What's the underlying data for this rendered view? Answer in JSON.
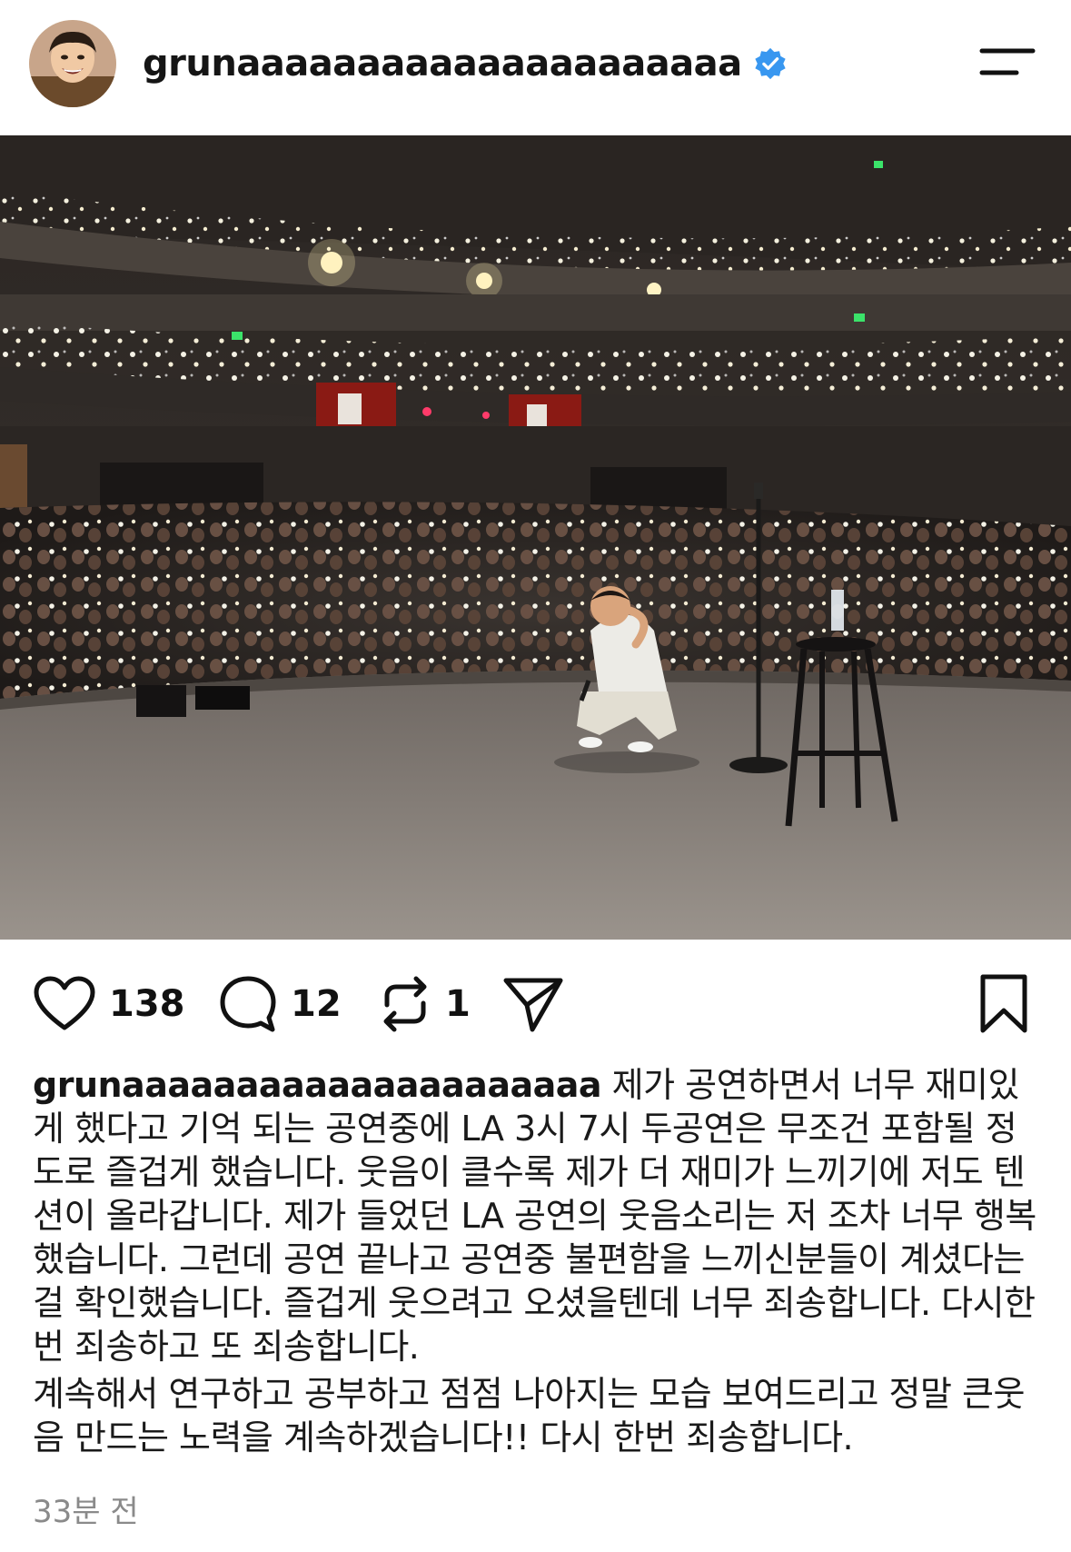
{
  "header": {
    "username": "grunaaaaaaaaaaaaaaaaaaaaa",
    "verified": true
  },
  "post": {
    "image_alt": "Comedian crouching on a theater stage with a packed audience holding phone flashlights",
    "actions": {
      "likes": "138",
      "comments": "12",
      "reposts": "1"
    },
    "caption": {
      "username": "grunaaaaaaaaaaaaaaaaaaaaa",
      "paragraph1": "제가 공연하면서 너무 재미있게 했다고 기억 되는 공연중에 LA 3시 7시 두공연은 무조건 포함될 정도로 즐겁게 했습니다. 웃음이 클수록 제가 더 재미가 느끼기에 저도 텐션이 올라갑니다. 제가 들었던 LA 공연의 웃음소리는 저 조차 너무 행복 했습니다. 그런데 공연 끝나고 공연중 불편함을 느끼신분들이 계셨다는걸 확인했습니다. 즐겁게 웃으려고 오셨을텐데 너무 죄송합니다. 다시한번 죄송하고 또 죄송합니다.",
      "paragraph2": "계속해서 연구하고 공부하고 점점 나아지는 모습 보여드리고 정말 큰웃음 만드는 노력을 계속하겠습니다!! 다시 한번 죄송합니다."
    },
    "timestamp": "33분 전"
  },
  "colors": {
    "verified_blue": "#3897f0",
    "text_primary": "#111111",
    "text_secondary": "#8a8a8a"
  }
}
